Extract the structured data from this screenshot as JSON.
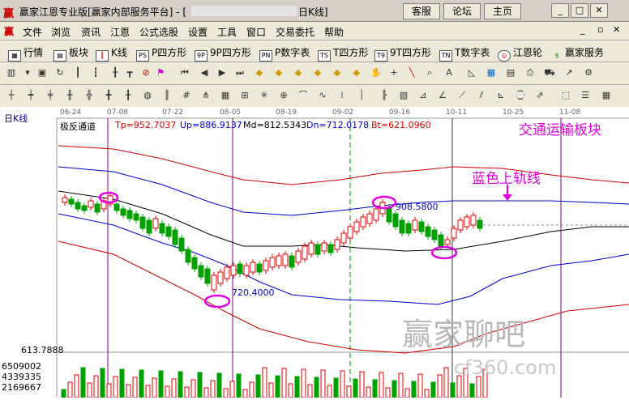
{
  "window": {
    "title": "赢家江恩专业版[赢家内部服务平台] - [",
    "title_tail": "日K线]",
    "buttons": [
      "客服",
      "论坛",
      "主页"
    ]
  },
  "menu": [
    "文件",
    "浏览",
    "资讯",
    "江恩",
    "公式选股",
    "设置",
    "工具",
    "窗口",
    "交易委托",
    "帮助"
  ],
  "toolbar1": [
    {
      "label": "行情",
      "icon": "grid-icon"
    },
    {
      "label": "板块",
      "icon": "block-icon"
    },
    {
      "label": "K线",
      "icon": "candle-icon"
    },
    {
      "label": "P四方形",
      "icon": "PS"
    },
    {
      "label": "9P四方形",
      "icon": "9P"
    },
    {
      "label": "P数字表",
      "icon": "PN"
    },
    {
      "label": "T四方形",
      "icon": "TS"
    },
    {
      "label": "9T四方形",
      "icon": "T9"
    },
    {
      "label": "T数字表",
      "icon": "TN"
    },
    {
      "label": "江恩轮",
      "icon": "wheel-icon"
    },
    {
      "label": "赢家服务",
      "icon": "dollar-icon"
    }
  ],
  "chart": {
    "period_label": "日K线",
    "indicator_name": "极反通道",
    "indicators": [
      {
        "label": "Tp=952.7037",
        "color": "#e00000"
      },
      {
        "label": "Up=886.9137",
        "color": "#0000e0"
      },
      {
        "label": "Md=812.5343",
        "color": "#000000"
      },
      {
        "label": "Dn=712.0178",
        "color": "#0000e0"
      },
      {
        "label": "Bt=621.0960",
        "color": "#e00000"
      }
    ],
    "dates": [
      "06-24",
      "07-08",
      "07-22",
      "08-05",
      "08-19",
      "09-02",
      "09-16",
      "10-11",
      "10-25",
      "11-08"
    ],
    "sector_annotation": "交通运输板块",
    "upper_rail_annotation": "蓝色上轨线",
    "high_label": "908.5800",
    "low_label": "720.4000",
    "price_low_scale": "613.7888",
    "volume_scale": [
      "6509002",
      "4339335",
      "2169667"
    ],
    "watermark": "赢家聊吧",
    "watermark_sub": "cf360.com",
    "colors": {
      "up": "#e00000",
      "down": "#00a000",
      "annotation": "#e000e0"
    }
  },
  "chart_data": {
    "type": "candlestick",
    "title": "",
    "bands": [
      "Tp",
      "Up",
      "Md",
      "Dn",
      "Bt"
    ],
    "last_values": {
      "Tp": 952.7037,
      "Up": 886.9137,
      "Md": 812.5343,
      "Dn": 712.0178,
      "Bt": 621.096
    },
    "x": [
      "06-24",
      "07-08",
      "07-22",
      "08-05",
      "08-19",
      "09-02",
      "09-16",
      "10-11",
      "10-25",
      "11-08"
    ],
    "highest": 908.58,
    "lowest": 720.4
  }
}
